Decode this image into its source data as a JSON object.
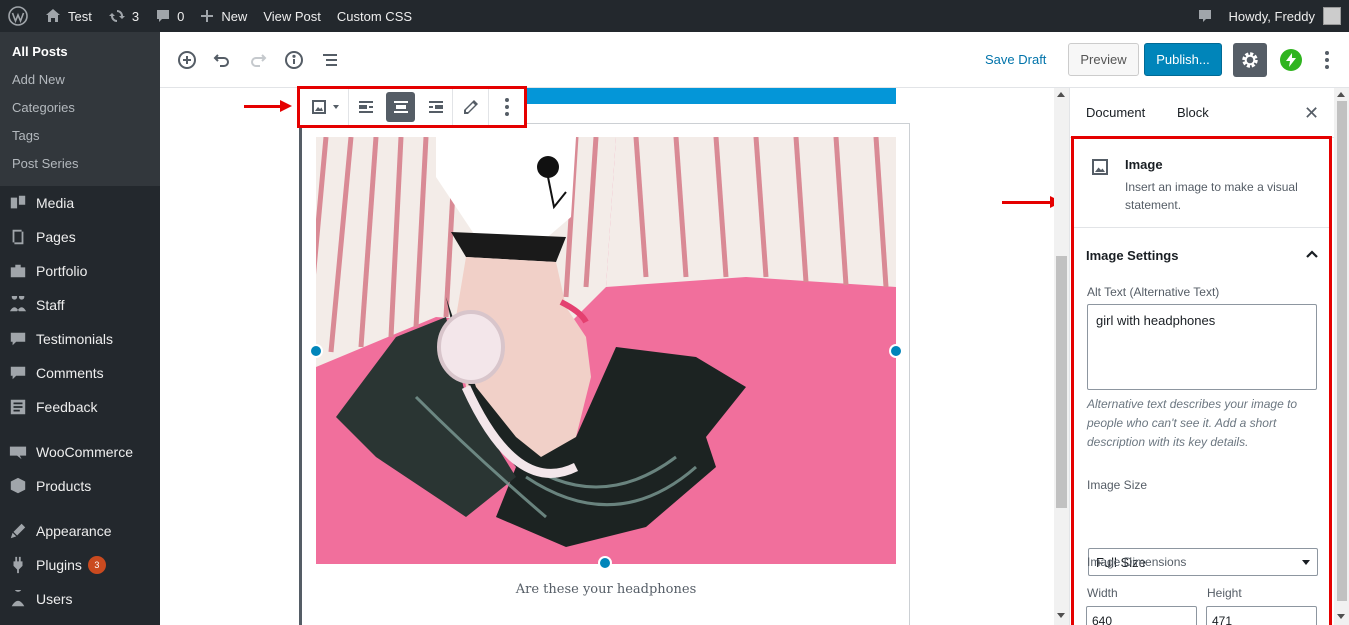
{
  "admin_bar": {
    "site_name": "Test",
    "updates_count": "3",
    "comments_count": "0",
    "new_label": "New",
    "view_post_label": "View Post",
    "custom_css_label": "Custom CSS",
    "greeting": "Howdy, Freddy"
  },
  "admin_menu": {
    "posts_submenu": [
      "All Posts",
      "Add New",
      "Categories",
      "Tags",
      "Post Series"
    ],
    "group1": [
      {
        "label": "Media",
        "icon": "media-icon"
      },
      {
        "label": "Pages",
        "icon": "pages-icon"
      },
      {
        "label": "Portfolio",
        "icon": "portfolio-icon"
      },
      {
        "label": "Staff",
        "icon": "staff-icon"
      },
      {
        "label": "Testimonials",
        "icon": "testimonials-icon"
      },
      {
        "label": "Comments",
        "icon": "comments-icon"
      },
      {
        "label": "Feedback",
        "icon": "feedback-icon"
      }
    ],
    "group2": [
      {
        "label": "WooCommerce",
        "icon": "woocommerce-icon"
      },
      {
        "label": "Products",
        "icon": "products-icon"
      }
    ],
    "group3": [
      {
        "label": "Appearance",
        "icon": "appearance-icon"
      },
      {
        "label": "Plugins",
        "icon": "plugins-icon"
      },
      {
        "label": "Users",
        "icon": "users-icon"
      }
    ],
    "plugins_badge": "3"
  },
  "header": {
    "save_draft": "Save Draft",
    "preview": "Preview",
    "publish": "Publish..."
  },
  "content": {
    "caption": "Are these your headphones"
  },
  "sidebar": {
    "tabs": [
      "Document",
      "Block"
    ],
    "block_title": "Image",
    "block_description": "Insert an image to make a visual statement.",
    "settings_title": "Image Settings",
    "alt_label": "Alt Text (Alternative Text)",
    "alt_value": "girl with headphones",
    "alt_help": "Alternative text describes your image to people who can't see it. Add a short description with its key details.",
    "size_label": "Image Size",
    "size_value": "Full Size",
    "dimensions_label": "Image Dimensions",
    "width_label": "Width",
    "height_label": "Height",
    "width_value": "640",
    "height_value": "471"
  },
  "colors": {
    "admin_dark": "#23282d",
    "accent_blue": "#0085ba",
    "highlight_red": "#e50000",
    "image_pink": "#f16f9c"
  }
}
